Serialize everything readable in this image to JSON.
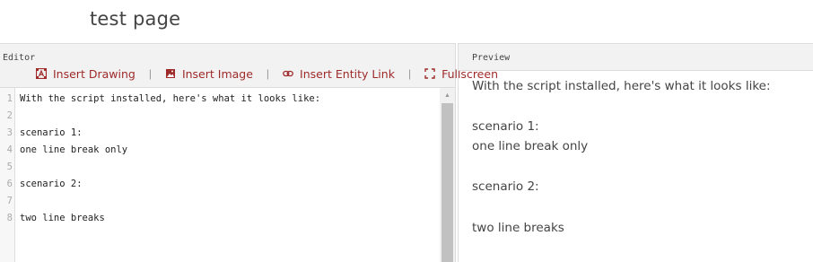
{
  "page": {
    "title": "test page"
  },
  "editor": {
    "label": "Editor",
    "toolbar": {
      "items": [
        {
          "label": "Insert Drawing",
          "icon": "insert-drawing-icon"
        },
        {
          "label": "Insert Image",
          "icon": "image-icon"
        },
        {
          "label": "Insert Entity Link",
          "icon": "link-icon"
        },
        {
          "label": "Fullscreen",
          "icon": "fullscreen-icon"
        }
      ],
      "separator": "|",
      "color": "#9e2a2a"
    },
    "lines": [
      {
        "num": "1",
        "text": "With the script installed, here's what it looks like:"
      },
      {
        "num": "2",
        "text": ""
      },
      {
        "num": "3",
        "text": "scenario 1:"
      },
      {
        "num": "4",
        "text": "one line break only"
      },
      {
        "num": "5",
        "text": ""
      },
      {
        "num": "6",
        "text": "scenario 2:"
      },
      {
        "num": "7",
        "text": ""
      },
      {
        "num": "8",
        "text": "two line breaks"
      }
    ]
  },
  "preview": {
    "label": "Preview",
    "lines": [
      "With the script installed, here's what it looks like:",
      "scenario 1:",
      "one line break only",
      "scenario 2:",
      "two line breaks"
    ]
  }
}
